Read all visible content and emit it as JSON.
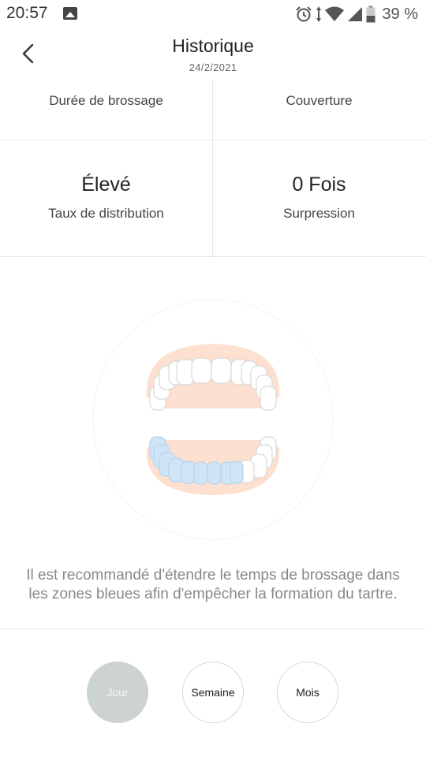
{
  "status": {
    "time": "20:57",
    "battery": "39 %",
    "icons": [
      "image-icon",
      "alarm-icon",
      "data-arrows-icon",
      "wifi-icon",
      "signal-icon",
      "battery-icon"
    ]
  },
  "header": {
    "title": "Historique",
    "date": "24/2/2021",
    "back_icon": "chevron-left-icon"
  },
  "stats": {
    "top_left_label": "Durée de brossage",
    "top_right_label": "Couverture",
    "bottom_left_value": "Élevé",
    "bottom_left_label": "Taux de distribution",
    "bottom_right_value": "0 Fois",
    "bottom_right_label": "Surpression"
  },
  "teeth": {
    "icon": "teeth-diagram-icon",
    "colors": {
      "gum": "#fde0cf",
      "highlight": "#cfe5f7",
      "tooth": "#ffffff",
      "outline": "#d8d8d8"
    }
  },
  "recommendation": "Il est recommandé d'étendre le temps de brossage dans les zones bleues afin d'empêcher la formation du tartre.",
  "periods": {
    "day": "Jour",
    "week": "Semaine",
    "month": "Mois",
    "selected": "Jour"
  }
}
